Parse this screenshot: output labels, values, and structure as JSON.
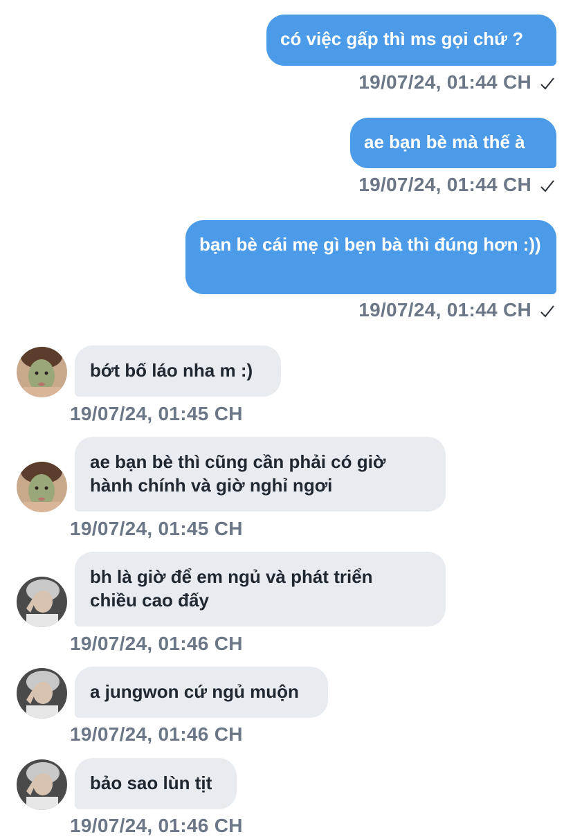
{
  "messages": [
    {
      "direction": "out",
      "text": "có việc gấp thì ms gọi chứ ?",
      "time": "19/07/24, 01:44 CH",
      "status": "sent-check"
    },
    {
      "direction": "out",
      "text": "ae bạn bè mà thế à",
      "time": "19/07/24, 01:44 CH",
      "status": "sent-check"
    },
    {
      "direction": "out",
      "text": "bạn bè cái mẹ gì bẹn bà thì đúng hơn :))",
      "time": "19/07/24, 01:44 CH",
      "status": "sent-check"
    },
    {
      "direction": "in",
      "avatar": "avatar-face-mask",
      "text": "bớt bố láo nha m :)",
      "time": "19/07/24, 01:45 CH"
    },
    {
      "direction": "in",
      "avatar": "avatar-face-mask",
      "text": "ae bạn bè thì cũng cần phải có giờ hành chính và giờ nghỉ ngơi",
      "time": "19/07/24, 01:45 CH"
    },
    {
      "direction": "in",
      "avatar": "avatar-silver-hair",
      "text": "bh là giờ để em ngủ và phát triển chiều cao đấy",
      "time": "19/07/24, 01:46 CH"
    },
    {
      "direction": "in",
      "avatar": "avatar-silver-hair",
      "text": "a jungwon cứ ngủ muộn",
      "time": "19/07/24, 01:46 CH"
    },
    {
      "direction": "in",
      "avatar": "avatar-silver-hair",
      "text": "bảo sao lùn tịt",
      "time": "19/07/24, 01:46 CH"
    }
  ],
  "colors": {
    "outgoing_bubble": "#4c9be8",
    "incoming_bubble": "#e8ebef",
    "timestamp_text": "#6b7787"
  }
}
